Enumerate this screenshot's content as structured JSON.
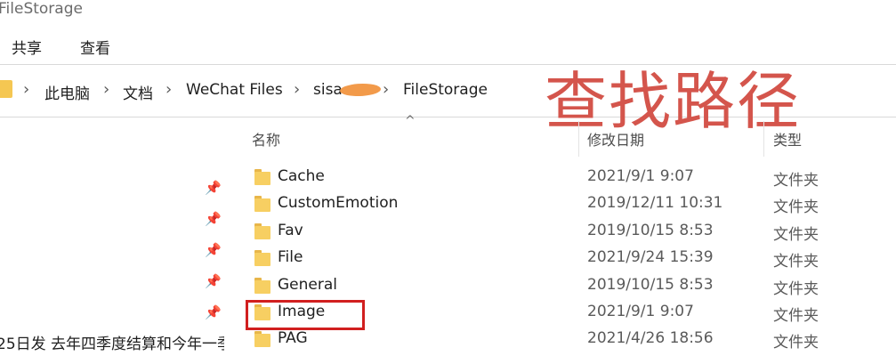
{
  "window": {
    "title": "FileStorage"
  },
  "ribbon": {
    "tabs": [
      "共享",
      "查看"
    ]
  },
  "address_bar": {
    "crumbs": [
      "此电脑",
      "文档",
      "WeChat Files",
      "sisa",
      "FileStorage"
    ]
  },
  "annotation": {
    "text": "查找路径",
    "color": "#d4554c"
  },
  "columns": {
    "name": "名称",
    "modified": "修改日期",
    "type": "类型"
  },
  "files": [
    {
      "name": "Cache",
      "date": "2021/9/1 9:07",
      "type": "文件夹"
    },
    {
      "name": "CustomEmotion",
      "date": "2019/12/11 10:31",
      "type": "文件夹"
    },
    {
      "name": "Fav",
      "date": "2019/10/15 8:53",
      "type": "文件夹"
    },
    {
      "name": "File",
      "date": "2021/9/24 15:39",
      "type": "文件夹"
    },
    {
      "name": "General",
      "date": "2019/10/15 8:53",
      "type": "文件夹"
    },
    {
      "name": "Image",
      "date": "2021/9/1 9:07",
      "type": "文件夹",
      "highlighted": true
    },
    {
      "name": "PAG",
      "date": "2021/4/26 18:56",
      "type": "文件夹"
    }
  ],
  "left_pane": {
    "snippet": "25日发 去年四季度结算和今年一季"
  },
  "icons": {
    "pin": "pin-icon",
    "folder": "folder-icon",
    "chevron": "chevron-right-icon",
    "sort": "sort-up-caret-icon"
  },
  "colors": {
    "folder": "#f7cf62",
    "highlight_border": "#d11f1f"
  }
}
